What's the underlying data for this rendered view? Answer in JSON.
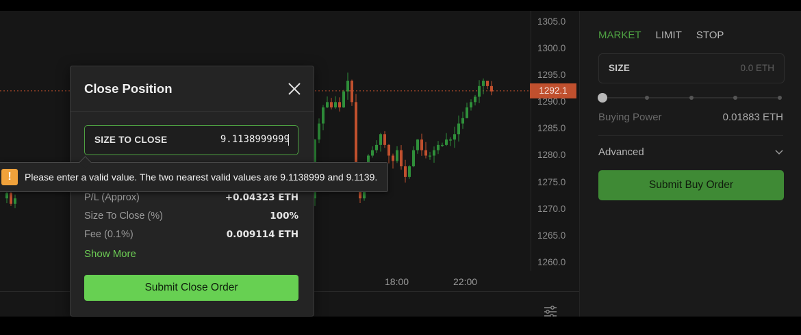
{
  "chart": {
    "price_ticks": [
      "1305.0",
      "1300.0",
      "1295.0",
      "1290.0",
      "1285.0",
      "1280.0",
      "1275.0",
      "1270.0",
      "1265.0",
      "1260.0"
    ],
    "current_price": "1292.1",
    "time_ticks": [
      "18:00",
      "22:00"
    ],
    "colors": {
      "up": "#2f8f3a",
      "down": "#c0502e"
    }
  },
  "order_panel": {
    "tabs": [
      {
        "label": "MARKET",
        "active": true
      },
      {
        "label": "LIMIT",
        "active": false
      },
      {
        "label": "STOP",
        "active": false
      }
    ],
    "size_label": "SIZE",
    "size_placeholder": "0.0 ETH",
    "buying_power_label": "Buying Power",
    "buying_power_value": "0.01883 ETH",
    "advanced_label": "Advanced",
    "submit_label": "Submit Buy Order"
  },
  "modal": {
    "title": "Close Position",
    "size_to_close_label": "SIZE TO CLOSE",
    "size_to_close_value": "9.1138999999",
    "rows": [
      {
        "label": "P/L (Approx)",
        "value": "+0.04323 ETH"
      },
      {
        "label": "Size To Close (%)",
        "value": "100%"
      },
      {
        "label": "Fee (0.1%)",
        "value": "0.009114 ETH"
      }
    ],
    "show_more_label": "Show More",
    "submit_label": "Submit Close Order"
  },
  "tooltip": {
    "icon": "warning-icon",
    "message": "Please enter a valid value. The two nearest valid values are 9.1138999 and 9.1139."
  },
  "theme": {
    "accent": "#67d052",
    "buy": "#3f8a35",
    "warning": "#f0a23b"
  }
}
